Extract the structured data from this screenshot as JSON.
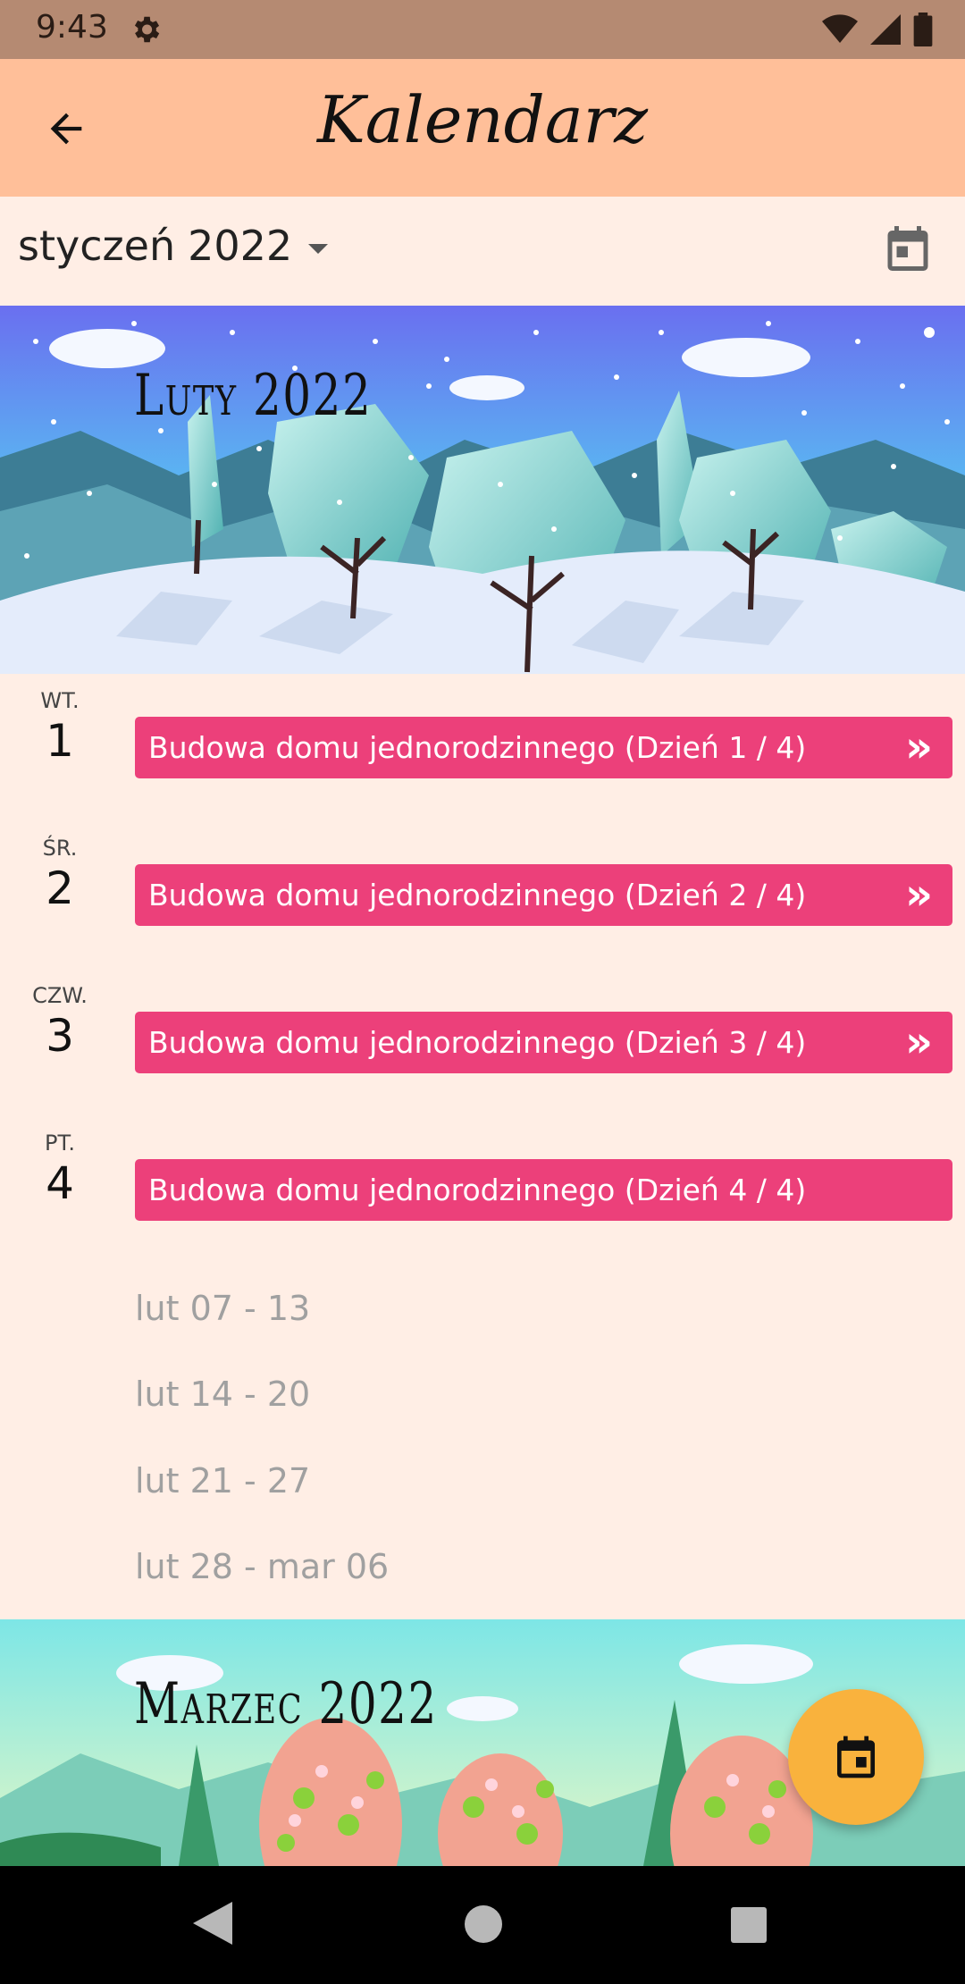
{
  "status_bar": {
    "time": "9:43"
  },
  "app_bar": {
    "title": "Kalendarz"
  },
  "month_selector": {
    "month": "styczeń",
    "year": "2022"
  },
  "banners": {
    "february": "Luty 2022",
    "march": "Marzec 2022"
  },
  "days": [
    {
      "weekday": "WT.",
      "number": "1",
      "event": "Budowa domu jednorodzinnego (Dzień 1 / 4)",
      "more": "»"
    },
    {
      "weekday": "ŚR.",
      "number": "2",
      "event": "Budowa domu jednorodzinnego (Dzień 2 / 4)",
      "more": "»"
    },
    {
      "weekday": "CZW.",
      "number": "3",
      "event": "Budowa domu jednorodzinnego (Dzień 3 / 4)",
      "more": "»"
    },
    {
      "weekday": "PT.",
      "number": "4",
      "event": "Budowa domu jednorodzinnego (Dzień 4 / 4)",
      "more": ""
    }
  ],
  "weeks": [
    "lut 07 - 13",
    "lut 14 - 20",
    "lut 21 - 27",
    "lut 28 - mar 06"
  ],
  "colors": {
    "app_bar": "#ffbf99",
    "background": "#ffeee5",
    "event": "#ec407a",
    "fab": "#f9b23d",
    "status_bar": "#b58a72"
  }
}
